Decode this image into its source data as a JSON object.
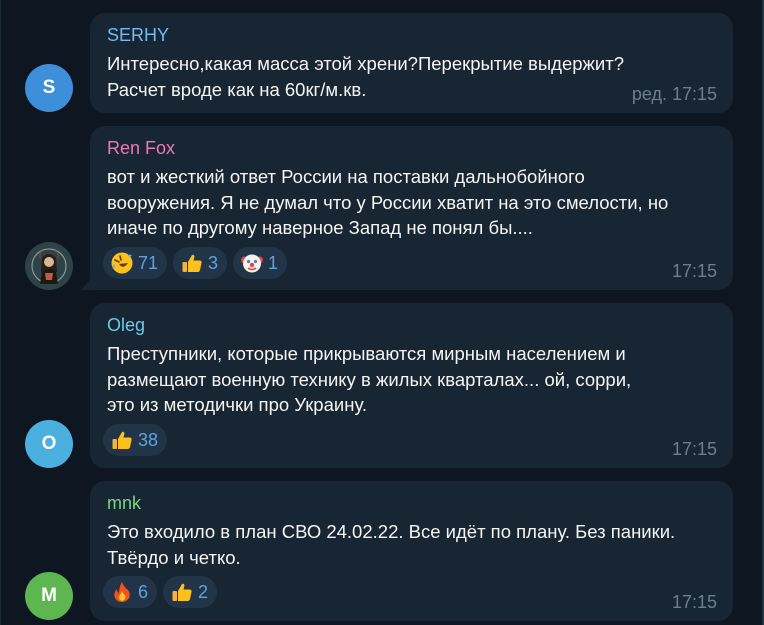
{
  "messages": [
    {
      "author": "SERHY",
      "author_color": "#71baf2",
      "avatar_letter": "S",
      "avatar_color": "#3d8fd9",
      "lines": [
        "Интересно,какая масса этой хрени?Перекрытие выдержит?",
        "Расчет вроде как на 60кг/м.кв."
      ],
      "time": "ред. 17:15",
      "reactions": []
    },
    {
      "author": "Ren Fox",
      "author_color": "#ee7aae",
      "avatar_letter": "",
      "avatar_color": "#2b3d3f",
      "lines": [
        "вот и жесткий ответ России на поставки дальнобойного",
        "вооружения. Я не думал что у России хватит на это смелости, но",
        "иначе по другому наверное Запад не понял бы...."
      ],
      "time": "17:15",
      "reactions": [
        {
          "icon": "rofl-emoji",
          "count": "71"
        },
        {
          "icon": "thumbs-up-emoji",
          "count": "3"
        },
        {
          "icon": "clown-emoji",
          "count": "1"
        }
      ]
    },
    {
      "author": "Oleg",
      "author_color": "#6ec9e6",
      "avatar_letter": "O",
      "avatar_color": "#4cb0de",
      "lines": [
        "Преступники, которые прикрываются мирным населением и",
        "размещают военную технику в жилых кварталах... ой, сорри,",
        "это из методички про Украину."
      ],
      "time": "17:15",
      "reactions": [
        {
          "icon": "thumbs-up-emoji",
          "count": "38"
        }
      ]
    },
    {
      "author": "mnk",
      "author_color": "#7fd483",
      "avatar_letter": "M",
      "avatar_color": "#5db64f",
      "lines": [
        "Это входило в план СВО 24.02.22. Все идёт по плану. Без паники.",
        "Твёрдо и четко."
      ],
      "time": "17:15",
      "reactions": [
        {
          "icon": "fire-emoji",
          "count": "6"
        },
        {
          "icon": "thumbs-up-emoji",
          "count": "2"
        }
      ]
    }
  ]
}
